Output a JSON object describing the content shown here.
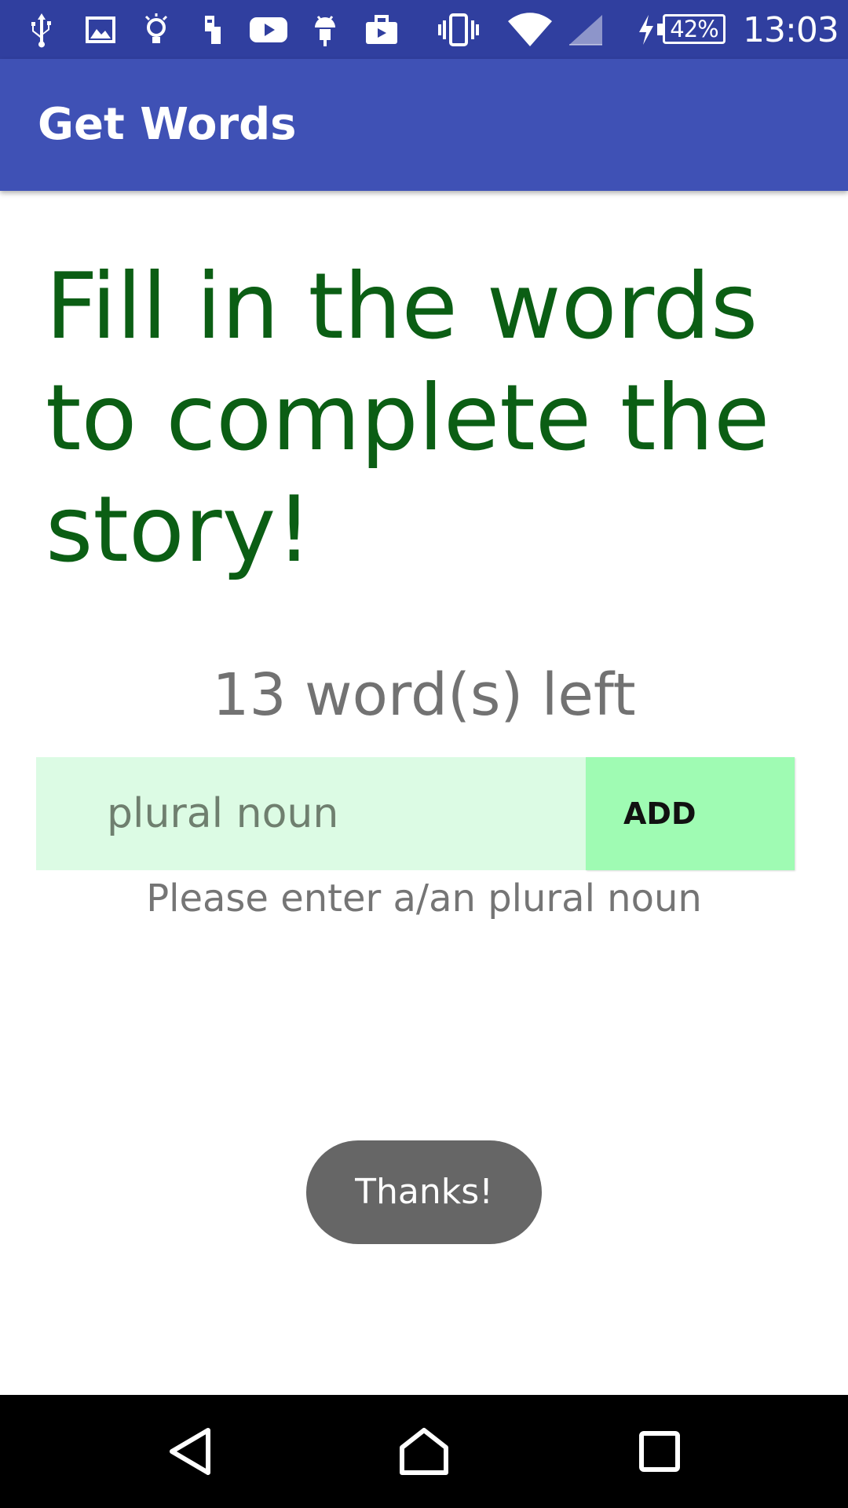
{
  "status_bar": {
    "icons": [
      "usb-icon",
      "image-icon",
      "lightbulb-icon",
      "sim-transfer-icon",
      "youtube-icon",
      "android-icon",
      "briefcase-icon",
      "vibrate-icon",
      "wifi-icon",
      "cell-signal-icon",
      "charging-icon"
    ],
    "battery_percent": "42%",
    "time": "13:03"
  },
  "app_bar": {
    "title": "Get Words"
  },
  "main": {
    "instructions": "Fill in the words to complete the story!",
    "words_left": "13 word(s) left",
    "input_placeholder": "plural noun",
    "input_value": "",
    "add_label": "ADD",
    "hint": "Please enter a/an plural noun"
  },
  "toast": {
    "text": "Thanks!"
  },
  "nav_bar": {
    "buttons": [
      "back-icon",
      "home-icon",
      "recents-icon"
    ]
  },
  "colors": {
    "status_bar": "#303F9F",
    "app_bar": "#3F51B5",
    "instructions_text": "#0B5E14",
    "input_bg": "#DCFBE4",
    "button_bg": "#9FFBB3",
    "toast_bg": "#666666"
  }
}
